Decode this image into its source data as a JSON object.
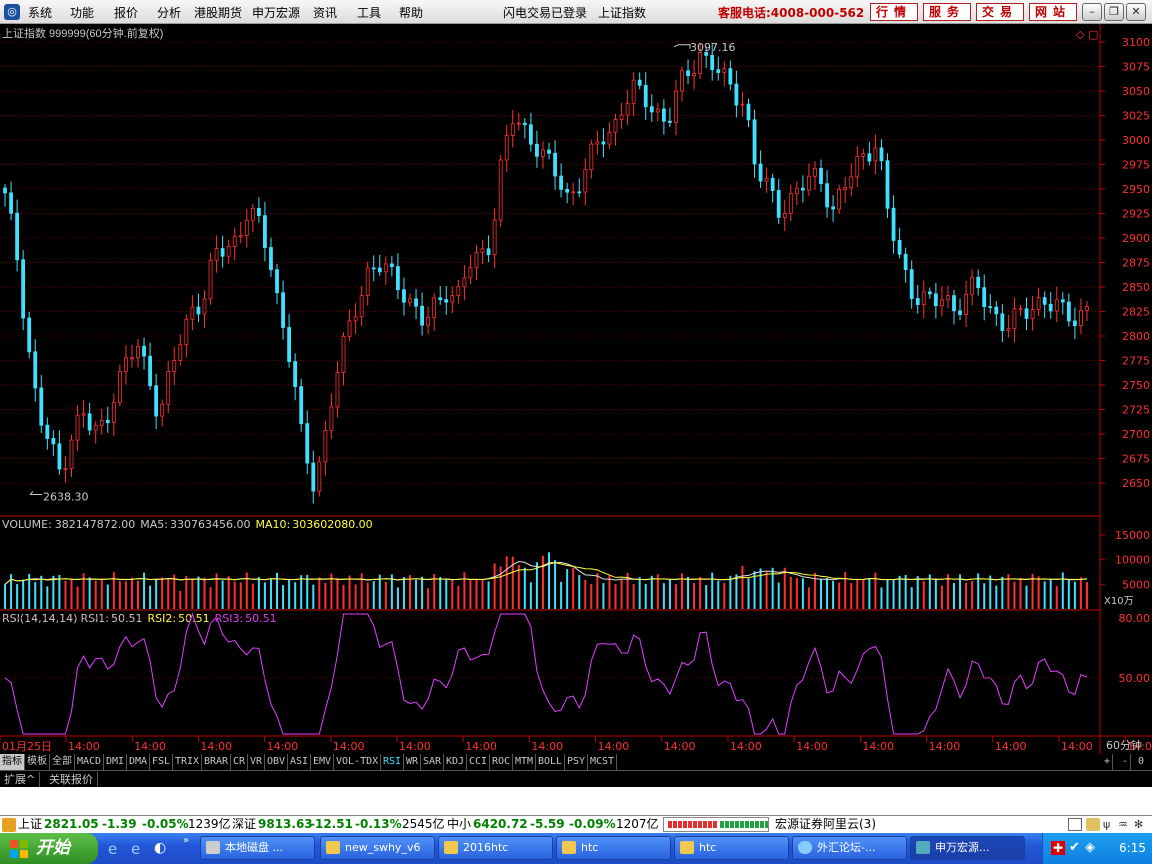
{
  "menubar": {
    "items": [
      "系统",
      "功能",
      "报价",
      "分析",
      "港股期货",
      "申万宏源",
      "资讯",
      "工具",
      "帮助"
    ],
    "login_status": "闪电交易已登录",
    "current_index": "上证指数",
    "hotline": "客服电话:4008-000-562",
    "service_buttons": [
      "行情",
      "服务",
      "交易",
      "网站"
    ]
  },
  "main_chart": {
    "title": "上证指数 999999(60分钟.前复权)",
    "high_label": "3097.16",
    "low_label": "2638.30",
    "y_ticks": [
      3100,
      3075,
      3050,
      3025,
      3000,
      2975,
      2950,
      2925,
      2900,
      2875,
      2850,
      2825,
      2800,
      2775,
      2750,
      2725,
      2700,
      2675,
      2650
    ],
    "colors": {
      "up": "#ff3030",
      "down": "#40e0ff",
      "axis": "#c00000",
      "grid": "#6a0000",
      "text": "#c8c8c8"
    }
  },
  "volume": {
    "label": "VOLUME:",
    "value": "382147872.00",
    "ma5_label": "MA5:",
    "ma5": "330763456.00",
    "ma10_label": "MA10:",
    "ma10": "303602080.00",
    "y_ticks": [
      "15000",
      "10000",
      "5000"
    ],
    "unit": "X10万",
    "ma10_color": "#ffff40"
  },
  "rsi": {
    "label": "RSI(14,14,14)",
    "rsi1_label": "RSI1:",
    "rsi1": "50.51",
    "rsi2_label": "RSI2:",
    "rsi2": "50.51",
    "rsi3_label": "RSI3:",
    "rsi3": "50.51",
    "y_ticks": [
      "80.00",
      "50.00"
    ],
    "line_color": "#e040ff"
  },
  "time_axis": {
    "labels": [
      "01月25日",
      "14:00",
      "14:00",
      "14:00",
      "14:00",
      "14:00",
      "14:00",
      "14:00",
      "14:00",
      "14:00",
      "14:00",
      "14:00",
      "14:00",
      "14:00",
      "14:00",
      "14:00",
      "14:00",
      "14:00"
    ],
    "period": "60分钟"
  },
  "indicator_tabs": [
    "指标",
    "模板",
    "全部",
    "MACD",
    "DMI",
    "DMA",
    "FSL",
    "TRIX",
    "BRAR",
    "CR",
    "VR",
    "OBV",
    "ASI",
    "EMV",
    "VOL-TDX",
    "RSI",
    "WR",
    "SAR",
    "KDJ",
    "CCI",
    "ROC",
    "MTM",
    "BOLL",
    "PSY",
    "MCST"
  ],
  "active_indicator": "RSI",
  "bottom_controls": [
    "+",
    "-",
    "0"
  ],
  "extra_tabs": [
    "扩展^",
    "关联报价"
  ],
  "statusbar": {
    "sh_name": "上证",
    "sh_value": "2821.05",
    "sh_change": "-1.39",
    "sh_pct": "-0.05%",
    "sh_amount": "1239亿",
    "sz_name": "深证",
    "sz_value": "9813.63",
    "sz_change": "-12.51",
    "sz_pct": "-0.13%",
    "sz_amount": "2545亿",
    "zx_name": "中小",
    "zx_value": "6420.72",
    "zx_change": "-5.59",
    "zx_pct": "-0.09%",
    "zx_amount": "1207亿",
    "server": "宏源证券阿里云(3)"
  },
  "taskbar": {
    "start": "开始",
    "tasks": [
      "本地磁盘 ...",
      "new_swhy_v6",
      "2016htc",
      "htc",
      "htc",
      "外汇论坛-...",
      "申万宏源..."
    ],
    "clock": "6:15"
  },
  "chart_data": {
    "type": "candlestick",
    "series_price_approx": [
      2940,
      2890,
      2800,
      2720,
      2690,
      2660,
      2700,
      2720,
      2700,
      2710,
      2750,
      2770,
      2790,
      2760,
      2720,
      2760,
      2800,
      2830,
      2840,
      2880,
      2890,
      2900,
      2930,
      2910,
      2880,
      2820,
      2770,
      2680,
      2650,
      2700,
      2760,
      2800,
      2840,
      2870,
      2870,
      2860,
      2850,
      2830,
      2810,
      2830,
      2850,
      2840,
      2870,
      2880,
      2900,
      2980,
      3020,
      3010,
      3000,
      2980,
      2960,
      2940,
      2960,
      2980,
      3000,
      3010,
      3040,
      3050,
      3040,
      3030,
      3020,
      3050,
      3070,
      3090,
      3080,
      3060,
      3050,
      3040,
      2970,
      2950,
      2930,
      2940,
      2950,
      2960,
      2960,
      2930,
      2950,
      2970,
      2990,
      3000,
      2920,
      2880,
      2850,
      2840,
      2830,
      2840,
      2830,
      2840,
      2850,
      2830,
      2820,
      2810,
      2820,
      2830,
      2840,
      2830,
      2820,
      2820,
      2830
    ],
    "high": 3097.16,
    "low": 2638.3,
    "ylim": [
      2630,
      3110
    ]
  }
}
